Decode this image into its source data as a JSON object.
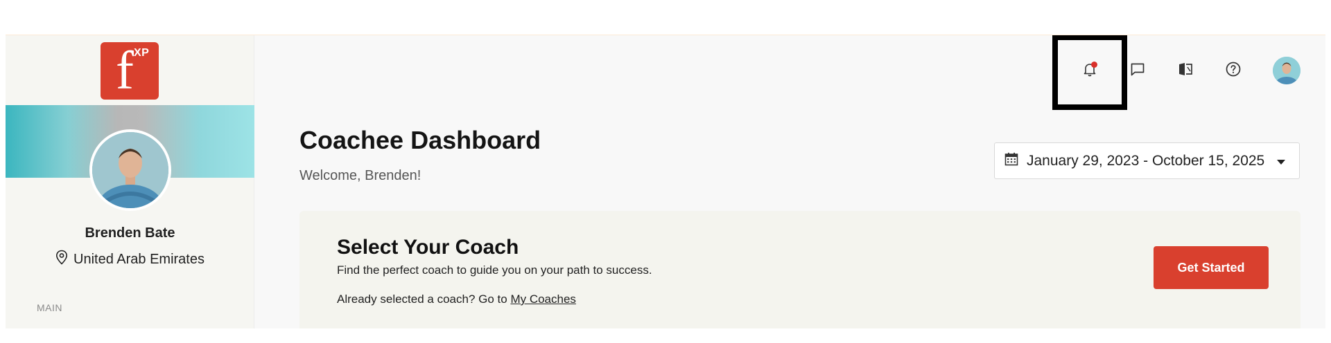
{
  "logo": {
    "letter": "f",
    "superscript": "XP",
    "brand_color": "#d9402e"
  },
  "profile": {
    "name": "Brenden Bate",
    "location": "United Arab Emirates"
  },
  "sidebar": {
    "section_label": "MAIN"
  },
  "topbar": {
    "icons": [
      "bell-icon",
      "chat-icon",
      "compare-icon",
      "help-icon",
      "user-avatar"
    ],
    "notification_dot_color": "#d9302a"
  },
  "header": {
    "title": "Coachee Dashboard",
    "welcome": "Welcome, Brenden!"
  },
  "date_range": {
    "label": "January 29, 2023 - October 15, 2025"
  },
  "coach_card": {
    "title": "Select Your Coach",
    "subtitle": "Find the perfect coach to guide you on your path to success.",
    "prompt": "Already selected a coach? Go to",
    "link": "My Coaches",
    "button": "Get Started"
  }
}
